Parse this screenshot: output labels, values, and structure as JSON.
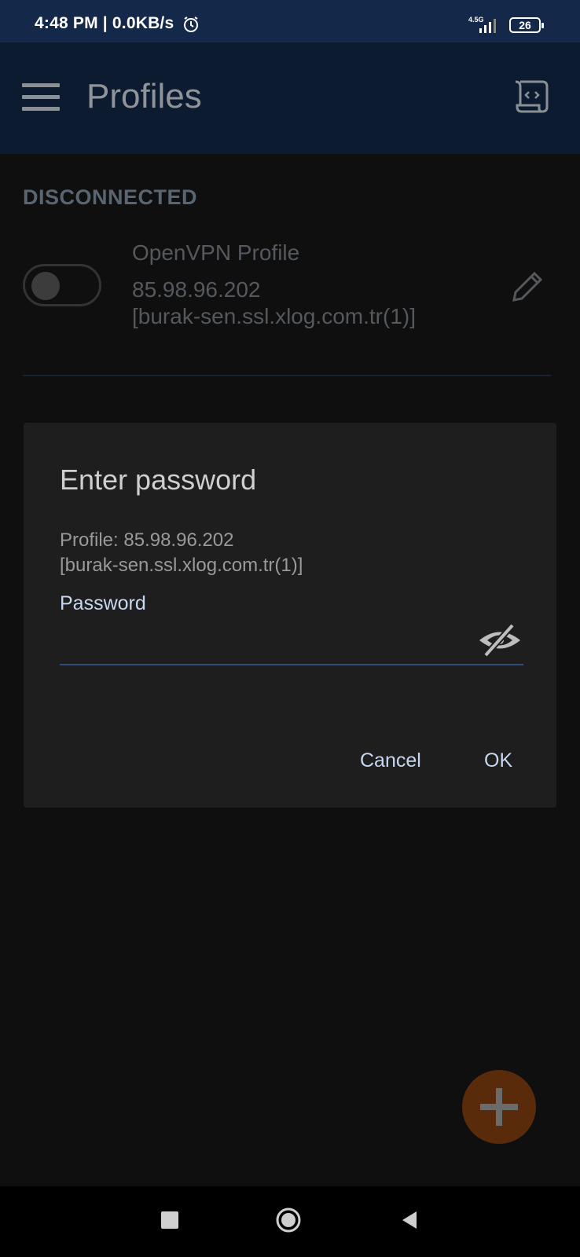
{
  "status_bar": {
    "time": "4:48 PM | 0.0KB/s",
    "network": "4.5G",
    "battery": "26"
  },
  "app_bar": {
    "title": "Profiles",
    "menu_icon": "hamburger-menu-icon",
    "action_icon": "script-code-icon"
  },
  "content": {
    "section_title": "DISCONNECTED",
    "profile": {
      "name": "OpenVPN Profile",
      "host_line1": "85.98.96.202",
      "host_line2": "[burak-sen.ssl.xlog.com.tr(1)]",
      "toggle_on": false
    }
  },
  "dialog": {
    "title": "Enter password",
    "message_line1": "Profile: 85.98.96.202",
    "message_line2": "[burak-sen.ssl.xlog.com.tr(1)]",
    "field_label": "Password",
    "password_value": "",
    "cancel_label": "Cancel",
    "ok_label": "OK"
  },
  "fab": {
    "icon": "plus-icon"
  },
  "nav_bar": {
    "icons": [
      "recents-square-icon",
      "home-circle-icon",
      "back-triangle-icon"
    ]
  },
  "colors": {
    "status_bar": "#14284a",
    "app_bar": "#0d1b30",
    "dialog_bg": "#1e1e1e",
    "accent": "#c6d8f0",
    "fab": "#5a2b0a"
  }
}
